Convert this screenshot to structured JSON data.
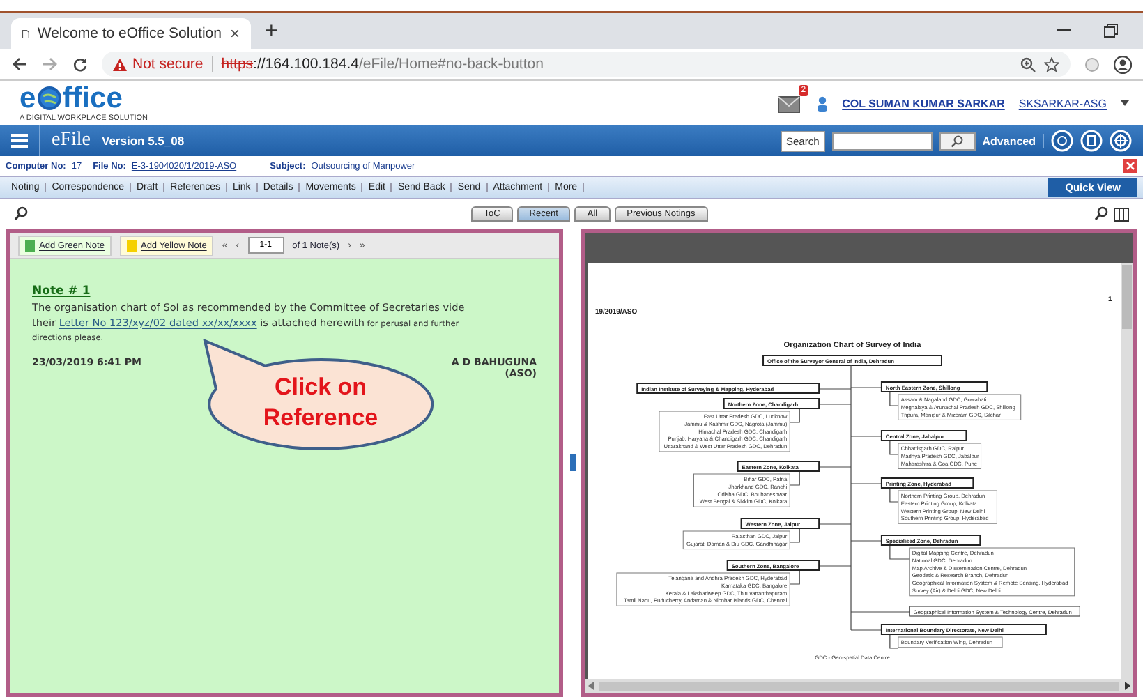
{
  "browser": {
    "tab_title": "Welcome to eOffice Solution",
    "tab_close": "×",
    "new_tab": "+",
    "security": "Not secure",
    "url_scheme": "https",
    "url_rest": "://164.100.184.4",
    "url_path": "/eFile/Home#no-back-button"
  },
  "header": {
    "logo_before": "e",
    "logo_after": "ffice",
    "tagline": "A DIGITAL WORKPLACE SOLUTION",
    "notification_count": "2",
    "user_name": "COL SUMAN KUMAR SARKAR",
    "user_id": "SKSARKAR-ASG"
  },
  "appbar": {
    "title": "eFile",
    "version": "Version 5.5_08",
    "search_label": "Search",
    "advanced": "Advanced"
  },
  "file_info": {
    "computer_label": "Computer No:",
    "computer_no": "17",
    "file_label": "File No:",
    "file_no": "E-3-1904020/1/2019-ASO",
    "subject_label": "Subject:",
    "subject": "Outsourcing of Manpower"
  },
  "menu": [
    "Noting",
    "Correspondence",
    "Draft",
    "References",
    "Link",
    "Details",
    "Movements",
    "Edit",
    "Send Back",
    "Send",
    "Attachment",
    "More"
  ],
  "quick_view": "Quick View",
  "view_tabs": [
    {
      "label": "ToC",
      "selected": false
    },
    {
      "label": "Recent",
      "selected": true
    },
    {
      "label": "All",
      "selected": false
    },
    {
      "label": "Previous Notings",
      "selected": false
    }
  ],
  "note_toolbar": {
    "add_green": "Add Green Note",
    "add_yellow": "Add Yellow Note",
    "first": "«",
    "prev": "‹",
    "range": "1-1",
    "count": "of **1** Note(s)",
    "next": "›",
    "last": "»"
  },
  "note": {
    "title": "Note # 1",
    "text_before": "The organisation chart of SoI as recommended by the Committee of Secretaries vide their ",
    "link": "Letter No 123/xyz/02 dated xx/xx/xxxx",
    "text_after": " is attached herewith",
    "text_small": " for perusal and further directions please.",
    "date": "23/03/2019 6:41 PM",
    "signer": "A D BAHUGUNA",
    "designation": "(ASO)"
  },
  "callout": "Click on Reference",
  "document": {
    "reference": "19/2019/ASO",
    "page": "1",
    "title": "Organization Chart of Survey of India",
    "root": "Office of the Surveyor General of India, Dehradun",
    "left_branches": [
      {
        "kind": "zone",
        "name": "Indian Institute of Surveying & Mapping, Hyderabad"
      },
      {
        "kind": "zone",
        "name": "Northern Zone, Chandigarh",
        "units": [
          "East Uttar Pradesh GDC, Lucknow",
          "Jammu & Kashmir GDC, Nagrota (Jammu)",
          "Himachal Pradesh GDC, Chandigarh",
          "Punjab, Haryana & Chandigarh GDC, Chandigarh",
          "Uttarakhand & West Uttar Pradesh GDC, Dehradun"
        ]
      },
      {
        "kind": "zone",
        "name": "Eastern Zone, Kolkata",
        "units": [
          "Bihar GDC, Patna",
          "Jharkhand GDC, Ranchi",
          "Odisha GDC, Bhubaneshwar",
          "West Bengal & Sikkim GDC, Kolkata"
        ]
      },
      {
        "kind": "zone",
        "name": "Western Zone, Jaipur",
        "units": [
          "Rajasthan GDC, Jaipur",
          "Gujarat, Daman & Diu GDC, Gandhinagar"
        ]
      },
      {
        "kind": "zone",
        "name": "Southern Zone, Bangalore",
        "units": [
          "Telangana and Andhra Pradesh GDC, Hyderabad",
          "Karnataka GDC, Bangalore",
          "Kerala & Lakshadweep GDC, Thiruvananthapuram",
          "Tamil Nadu, Puducherry, Andaman & Nicobar Islands GDC, Chennai"
        ]
      }
    ],
    "right_branches": [
      {
        "kind": "zone",
        "name": "North Eastern Zone, Shillong",
        "units": [
          "Assam & Nagaland GDC, Guwahati",
          "Meghalaya & Arunachal Pradesh GDC, Shillong",
          "Tripura, Manipur & Mizoram GDC, Silchar"
        ]
      },
      {
        "kind": "zone",
        "name": "Central Zone, Jabalpur",
        "units": [
          "Chhattisgarh GDC, Raipur",
          "Madhya Pradesh GDC, Jabalpur",
          "Maharashtra & Goa GDC, Pune"
        ]
      },
      {
        "kind": "zone",
        "name": "Printing Zone, Hyderabad",
        "units": [
          "Northern Printing Group, Dehradun",
          "Eastern Printing Group, Kolkata",
          "Western Printing Group, New Delhi",
          "Southern Printing Group, Hyderabad"
        ]
      },
      {
        "kind": "zone",
        "name": "Specialised Zone, Dehradun",
        "units": [
          "Digital Mapping Centre, Dehradun",
          "National GDC, Dehradun",
          "Map Archive & Dissemination Centre, Dehradun",
          "Geodetic & Research Branch, Dehradun",
          "Geographical Information System & Remote Sensing, Hyderabad",
          "Survey (Air) & Delhi GDC, New Delhi"
        ]
      },
      {
        "kind": "unit",
        "name": "Geographical Information System & Technology Centre, Dehradun"
      },
      {
        "kind": "zone",
        "name": "International Boundary Directorate, New Delhi",
        "units": [
          "Boundary Verification Wing, Dehradun"
        ]
      }
    ],
    "footnote": "GDC - Geo-spatial Data Centre"
  }
}
